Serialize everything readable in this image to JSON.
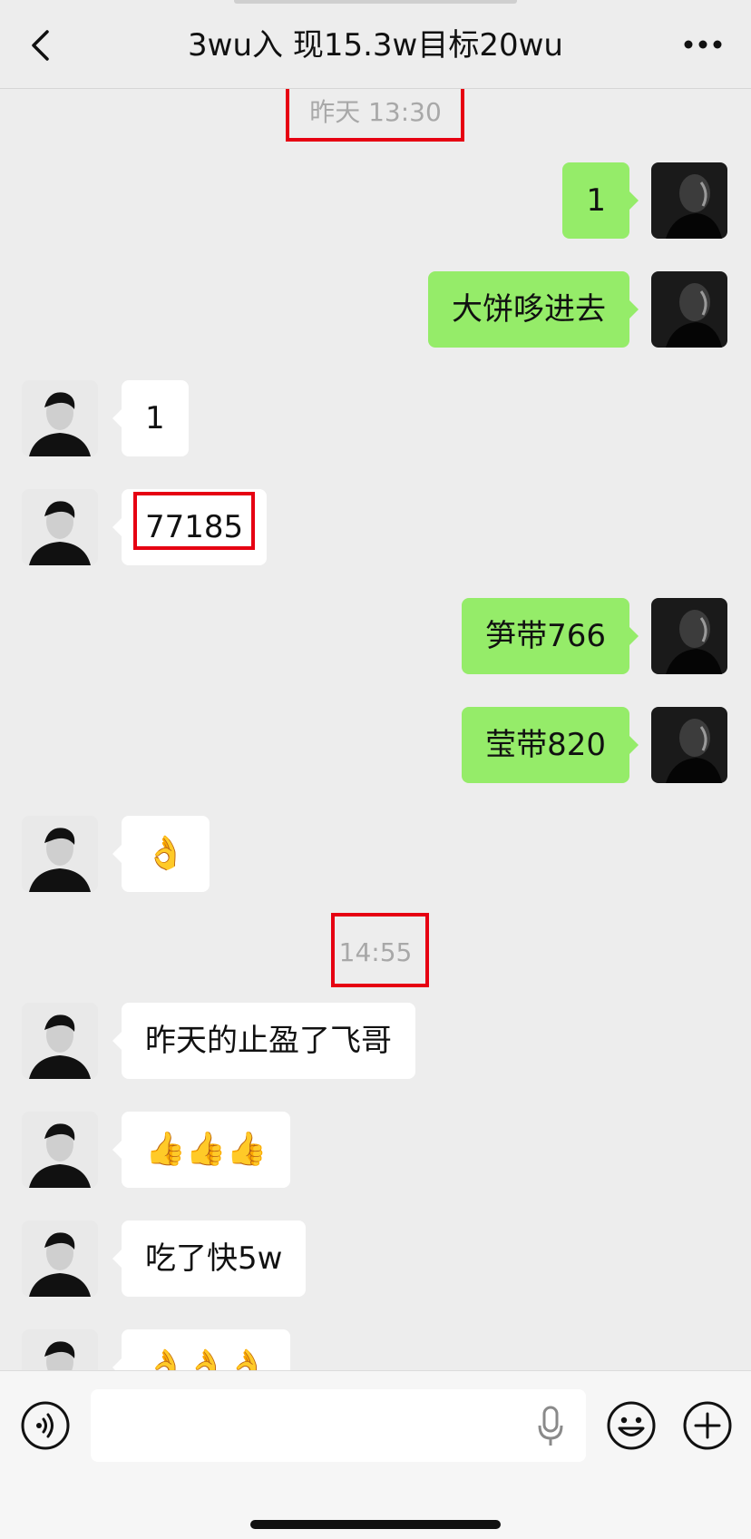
{
  "header": {
    "title": "3wu入 现15.3w目标20wu",
    "back_icon": "chevron-left-icon",
    "more_icon": "more-dots-icon"
  },
  "timestamps": [
    "昨天 13:30",
    "14:55"
  ],
  "messages": [
    {
      "side": "out",
      "text": "1"
    },
    {
      "side": "out",
      "text": "大饼哆进去"
    },
    {
      "side": "in",
      "text": "1"
    },
    {
      "side": "in",
      "text": "77185"
    },
    {
      "side": "out",
      "text": "笋带766"
    },
    {
      "side": "out",
      "text": "莹带820"
    },
    {
      "side": "in",
      "text": "👌"
    },
    {
      "side": "in",
      "text": "昨天的止盈了飞哥"
    },
    {
      "side": "in",
      "text": "👍👍👍"
    },
    {
      "side": "in",
      "text": "吃了快5w"
    },
    {
      "side": "in",
      "text": "👌👌👌"
    }
  ],
  "input": {
    "value": "",
    "placeholder": "",
    "icons": [
      "voice-icon",
      "mic-icon",
      "emoji-icon",
      "plus-icon"
    ]
  },
  "colors": {
    "background": "#ededed",
    "outgoing_bubble": "#95ec69",
    "incoming_bubble": "#ffffff",
    "highlight": "#e60012"
  }
}
